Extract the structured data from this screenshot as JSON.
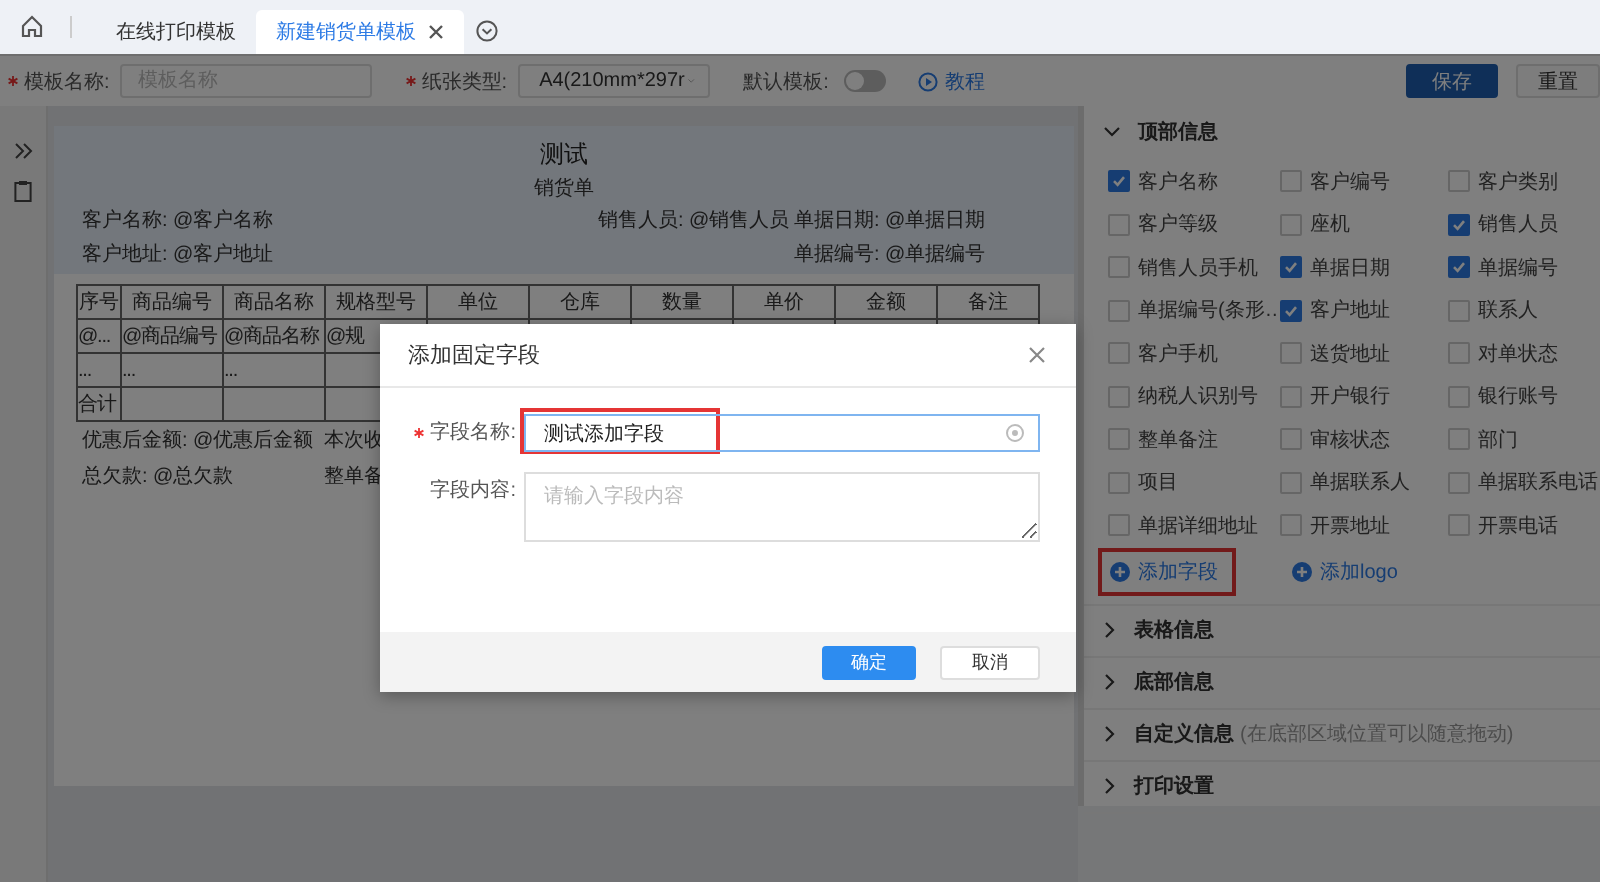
{
  "tabs": [
    {
      "label": "在线打印模板",
      "selected": false,
      "closable": false
    },
    {
      "label": "新建销货单模板",
      "selected": true,
      "closable": true
    }
  ],
  "toolbar": {
    "template_name": {
      "label": "模板名称:",
      "required": true,
      "placeholder": "模板名称"
    },
    "paper_type": {
      "label": "纸张类型:",
      "required": true,
      "value": "A4(210mm*297r"
    },
    "default_template": {
      "label": "默认模板:",
      "on": false
    },
    "tutorial_link": "教程",
    "buttons": [
      {
        "label": "保存",
        "kind": "primary"
      },
      {
        "label": "重置",
        "kind": "default"
      }
    ]
  },
  "paper": {
    "title": "测试",
    "subtitle": "销货单",
    "info_rows": [
      {
        "left": "客户名称: @客户名称",
        "middle": "销售人员: @销售人员",
        "right": "单据日期: @单据日期"
      },
      {
        "left": "客户地址: @客户地址",
        "right": "单据编号: @单据编号"
      }
    ],
    "table": {
      "columns": [
        "序号",
        "商品编号",
        "商品名称",
        "规格型号",
        "单位",
        "仓库",
        "数量",
        "单价",
        "金额",
        "备注"
      ],
      "rows": [
        [
          "@...",
          "@商品编号",
          "@商品名称",
          "@规"
        ],
        [
          "...",
          "...",
          "..."
        ],
        [
          "合计"
        ]
      ]
    },
    "summary_rows": [
      {
        "left": "优惠后金额: @优惠后金额",
        "right": "本次收"
      },
      {
        "left": "总欠款: @总欠款",
        "right": "整单备"
      }
    ]
  },
  "panel": {
    "sections": [
      {
        "title": "顶部信息",
        "expanded": true,
        "fields": [
          {
            "label": "客户名称",
            "checked": true
          },
          {
            "label": "客户编号",
            "checked": false
          },
          {
            "label": "客户类别",
            "checked": false
          },
          {
            "label": "客户等级",
            "checked": false
          },
          {
            "label": "座机",
            "checked": false
          },
          {
            "label": "销售人员",
            "checked": true
          },
          {
            "label": "销售人员手机",
            "checked": false
          },
          {
            "label": "单据日期",
            "checked": true
          },
          {
            "label": "单据编号",
            "checked": true
          },
          {
            "label": "单据编号(条形…",
            "checked": false
          },
          {
            "label": "客户地址",
            "checked": true
          },
          {
            "label": "联系人",
            "checked": false
          },
          {
            "label": "客户手机",
            "checked": false
          },
          {
            "label": "送货地址",
            "checked": false
          },
          {
            "label": "对单状态",
            "checked": false
          },
          {
            "label": "纳税人识别号",
            "checked": false
          },
          {
            "label": "开户银行",
            "checked": false
          },
          {
            "label": "银行账号",
            "checked": false
          },
          {
            "label": "整单备注",
            "checked": false
          },
          {
            "label": "审核状态",
            "checked": false
          },
          {
            "label": "部门",
            "checked": false
          },
          {
            "label": "项目",
            "checked": false
          },
          {
            "label": "单据联系人",
            "checked": false
          },
          {
            "label": "单据联系电话",
            "checked": false
          },
          {
            "label": "单据详细地址",
            "checked": false
          },
          {
            "label": "开票地址",
            "checked": false
          },
          {
            "label": "开票电话",
            "checked": false
          }
        ],
        "actions": [
          {
            "label": "添加字段",
            "highlighted": true
          },
          {
            "label": "添加logo",
            "highlighted": false
          }
        ]
      },
      {
        "title": "表格信息",
        "expanded": false
      },
      {
        "title": "底部信息",
        "expanded": false
      },
      {
        "title": "自定义信息",
        "hint": "(在底部区域位置可以随意拖动)",
        "expanded": false
      },
      {
        "title": "打印设置",
        "expanded": false
      }
    ]
  },
  "modal": {
    "title": "添加固定字段",
    "fields": [
      {
        "kind": "input",
        "label": "字段名称:",
        "required": true,
        "value": "测试添加字段",
        "highlighted": true
      },
      {
        "kind": "textarea",
        "label": "字段内容:",
        "required": false,
        "placeholder": "请输入字段内容"
      }
    ],
    "buttons": [
      {
        "label": "确定",
        "kind": "primary"
      },
      {
        "label": "取消",
        "kind": "default"
      }
    ]
  }
}
